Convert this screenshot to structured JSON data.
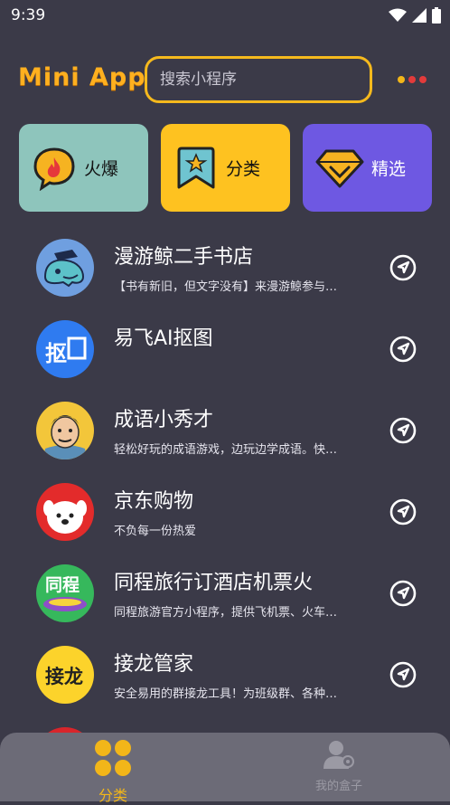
{
  "status_bar": {
    "time": "9:39"
  },
  "header": {
    "logo": "Mini App",
    "search_placeholder": "搜索小程序",
    "more_dot_colors": [
      "#f2b619",
      "#e23b3b",
      "#e23b3b"
    ]
  },
  "tiles": [
    {
      "label": "火爆",
      "bg": "#8ec5bc",
      "icon": "fire-chat-icon"
    },
    {
      "label": "分类",
      "bg": "#fec220",
      "icon": "star-bookmark-icon"
    },
    {
      "label": "精选",
      "bg": "#6e58e2",
      "icon": "gem-icon"
    }
  ],
  "apps": [
    {
      "name": "漫游鲸二手书店",
      "desc": "【书有新旧，但文字没有】来漫游鲸参与…",
      "icon": "whale-avatar"
    },
    {
      "name": "易飞AI抠图",
      "desc": "",
      "icon": "koutu-avatar",
      "badge": "抠"
    },
    {
      "name": "成语小秀才",
      "desc": "轻松好玩的成语游戏，边玩边学成语。快…",
      "icon": "scholar-avatar"
    },
    {
      "name": "京东购物",
      "desc": "不负每一份热爱",
      "icon": "jd-dog-avatar"
    },
    {
      "name": "同程旅行订酒店机票火",
      "desc": "同程旅游官方小程序，提供飞机票、火车…",
      "icon": "tongcheng-avatar",
      "badge": "同程"
    },
    {
      "name": "接龙管家",
      "desc": "安全易用的群接龙工具！为班级群、各种…",
      "icon": "jielong-avatar",
      "badge": "接龙"
    }
  ],
  "bottom_nav": {
    "categories_label": "分类",
    "my_box_label": "我的盒子",
    "accent": "#f2b619"
  }
}
